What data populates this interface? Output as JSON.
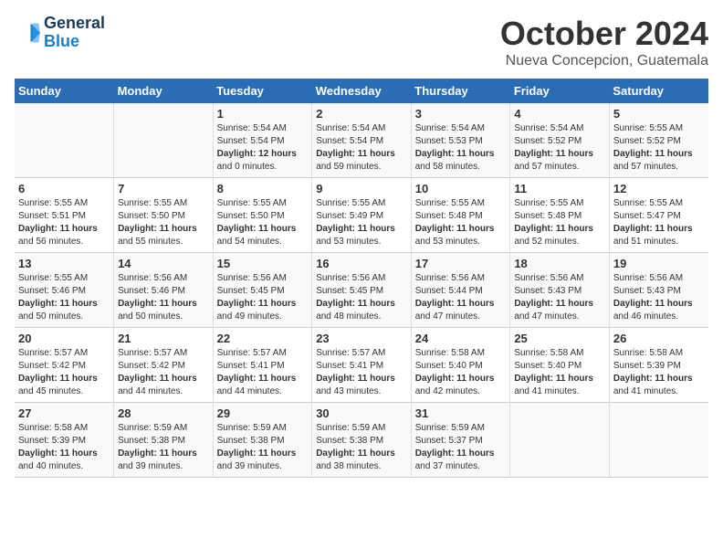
{
  "header": {
    "logo_line1": "General",
    "logo_line2": "Blue",
    "month": "October 2024",
    "location": "Nueva Concepcion, Guatemala"
  },
  "days_of_week": [
    "Sunday",
    "Monday",
    "Tuesday",
    "Wednesday",
    "Thursday",
    "Friday",
    "Saturday"
  ],
  "weeks": [
    [
      {
        "day": "",
        "info": ""
      },
      {
        "day": "",
        "info": ""
      },
      {
        "day": "1",
        "info": "Sunrise: 5:54 AM\nSunset: 5:54 PM\nDaylight: 12 hours\nand 0 minutes."
      },
      {
        "day": "2",
        "info": "Sunrise: 5:54 AM\nSunset: 5:54 PM\nDaylight: 11 hours\nand 59 minutes."
      },
      {
        "day": "3",
        "info": "Sunrise: 5:54 AM\nSunset: 5:53 PM\nDaylight: 11 hours\nand 58 minutes."
      },
      {
        "day": "4",
        "info": "Sunrise: 5:54 AM\nSunset: 5:52 PM\nDaylight: 11 hours\nand 57 minutes."
      },
      {
        "day": "5",
        "info": "Sunrise: 5:55 AM\nSunset: 5:52 PM\nDaylight: 11 hours\nand 57 minutes."
      }
    ],
    [
      {
        "day": "6",
        "info": "Sunrise: 5:55 AM\nSunset: 5:51 PM\nDaylight: 11 hours\nand 56 minutes."
      },
      {
        "day": "7",
        "info": "Sunrise: 5:55 AM\nSunset: 5:50 PM\nDaylight: 11 hours\nand 55 minutes."
      },
      {
        "day": "8",
        "info": "Sunrise: 5:55 AM\nSunset: 5:50 PM\nDaylight: 11 hours\nand 54 minutes."
      },
      {
        "day": "9",
        "info": "Sunrise: 5:55 AM\nSunset: 5:49 PM\nDaylight: 11 hours\nand 53 minutes."
      },
      {
        "day": "10",
        "info": "Sunrise: 5:55 AM\nSunset: 5:48 PM\nDaylight: 11 hours\nand 53 minutes."
      },
      {
        "day": "11",
        "info": "Sunrise: 5:55 AM\nSunset: 5:48 PM\nDaylight: 11 hours\nand 52 minutes."
      },
      {
        "day": "12",
        "info": "Sunrise: 5:55 AM\nSunset: 5:47 PM\nDaylight: 11 hours\nand 51 minutes."
      }
    ],
    [
      {
        "day": "13",
        "info": "Sunrise: 5:55 AM\nSunset: 5:46 PM\nDaylight: 11 hours\nand 50 minutes."
      },
      {
        "day": "14",
        "info": "Sunrise: 5:56 AM\nSunset: 5:46 PM\nDaylight: 11 hours\nand 50 minutes."
      },
      {
        "day": "15",
        "info": "Sunrise: 5:56 AM\nSunset: 5:45 PM\nDaylight: 11 hours\nand 49 minutes."
      },
      {
        "day": "16",
        "info": "Sunrise: 5:56 AM\nSunset: 5:45 PM\nDaylight: 11 hours\nand 48 minutes."
      },
      {
        "day": "17",
        "info": "Sunrise: 5:56 AM\nSunset: 5:44 PM\nDaylight: 11 hours\nand 47 minutes."
      },
      {
        "day": "18",
        "info": "Sunrise: 5:56 AM\nSunset: 5:43 PM\nDaylight: 11 hours\nand 47 minutes."
      },
      {
        "day": "19",
        "info": "Sunrise: 5:56 AM\nSunset: 5:43 PM\nDaylight: 11 hours\nand 46 minutes."
      }
    ],
    [
      {
        "day": "20",
        "info": "Sunrise: 5:57 AM\nSunset: 5:42 PM\nDaylight: 11 hours\nand 45 minutes."
      },
      {
        "day": "21",
        "info": "Sunrise: 5:57 AM\nSunset: 5:42 PM\nDaylight: 11 hours\nand 44 minutes."
      },
      {
        "day": "22",
        "info": "Sunrise: 5:57 AM\nSunset: 5:41 PM\nDaylight: 11 hours\nand 44 minutes."
      },
      {
        "day": "23",
        "info": "Sunrise: 5:57 AM\nSunset: 5:41 PM\nDaylight: 11 hours\nand 43 minutes."
      },
      {
        "day": "24",
        "info": "Sunrise: 5:58 AM\nSunset: 5:40 PM\nDaylight: 11 hours\nand 42 minutes."
      },
      {
        "day": "25",
        "info": "Sunrise: 5:58 AM\nSunset: 5:40 PM\nDaylight: 11 hours\nand 41 minutes."
      },
      {
        "day": "26",
        "info": "Sunrise: 5:58 AM\nSunset: 5:39 PM\nDaylight: 11 hours\nand 41 minutes."
      }
    ],
    [
      {
        "day": "27",
        "info": "Sunrise: 5:58 AM\nSunset: 5:39 PM\nDaylight: 11 hours\nand 40 minutes."
      },
      {
        "day": "28",
        "info": "Sunrise: 5:59 AM\nSunset: 5:38 PM\nDaylight: 11 hours\nand 39 minutes."
      },
      {
        "day": "29",
        "info": "Sunrise: 5:59 AM\nSunset: 5:38 PM\nDaylight: 11 hours\nand 39 minutes."
      },
      {
        "day": "30",
        "info": "Sunrise: 5:59 AM\nSunset: 5:38 PM\nDaylight: 11 hours\nand 38 minutes."
      },
      {
        "day": "31",
        "info": "Sunrise: 5:59 AM\nSunset: 5:37 PM\nDaylight: 11 hours\nand 37 minutes."
      },
      {
        "day": "",
        "info": ""
      },
      {
        "day": "",
        "info": ""
      }
    ]
  ]
}
